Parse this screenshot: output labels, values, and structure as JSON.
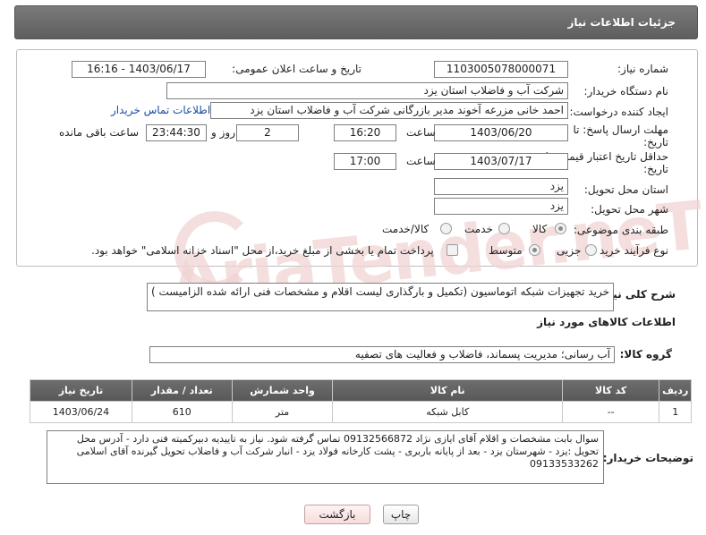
{
  "header": {
    "title": "جزئیات اطلاعات نیاز"
  },
  "form": {
    "need_number_label": "شماره نیاز:",
    "need_number": "1103005078000071",
    "announce_label": "تاریخ و ساعت اعلان عمومی:",
    "announce_value": "1403/06/17 - 16:16",
    "buyer_org_label": "نام دستگاه خریدار:",
    "buyer_org": "شرکت آب و فاضلاب استان یزد",
    "requester_label": "ایجاد کننده درخواست:",
    "requester": "احمد خانی مزرعه آخوند مدیر بازرگانی شرکت آب و فاضلاب استان یزد",
    "contact_link": "اطلاعات تماس خریدار",
    "deadline_label_1": "مهلت ارسال پاسخ: تا",
    "deadline_label_2": "تاریخ:",
    "deadline_date": "1403/06/20",
    "time_label": "ساعت",
    "deadline_time": "16:20",
    "days_value": "2",
    "days_label": "روز و",
    "remaining_time": "23:44:30",
    "remaining_label": "ساعت باقی مانده",
    "validity_label_1": "حداقل تاریخ اعتبار قیمت: تا",
    "validity_label_2": "تاریخ:",
    "validity_date": "1403/07/17",
    "validity_time": "17:00",
    "province_label": "استان محل تحویل:",
    "province": "یزد",
    "city_label": "شهر محل تحویل:",
    "city": "یزد",
    "category_label": "طبقه بندی موضوعی:",
    "category_options": [
      "کالا",
      "خدمت",
      "کالا/خدمت"
    ],
    "purchase_type_label": "نوع فرآیند خرید :",
    "purchase_options": [
      "جزیی",
      "متوسط"
    ],
    "payment_note": "پرداخت تمام یا بخشی از مبلغ خرید،از محل \"اسناد خزانه اسلامی\" خواهد بود."
  },
  "description": {
    "label": "شرح کلی نیاز:",
    "text": "خرید تجهیزات شبکه اتوماسیون  (تکمیل و بارگذاری لیست اقلام و مشخصات فنی ارائه شده الزامیست )"
  },
  "goods_section": {
    "title": "اطلاعات کالاهای مورد نیاز",
    "group_label": "گروه کالا:",
    "group_value": "آب رسانی؛ مدیریت پسماند، فاضلاب و فعالیت های تصفیه"
  },
  "table": {
    "headers": [
      "ردیف",
      "کد کالا",
      "نام کالا",
      "واحد شمارش",
      "تعداد / مقدار",
      "تاریخ نیاز"
    ],
    "rows": [
      [
        "1",
        "--",
        "کابل شبکه",
        "متر",
        "610",
        "1403/06/24"
      ]
    ]
  },
  "buyer_notes": {
    "label": "توضیحات خریدار:",
    "text": "سوال بابت مشخصات و اقلام آقای ایازی نژاد 09132566872 تماس گرفته شود. نیاز به تاییدیه دبیرکمیته فنی دارد - آدرس محل تحویل :یزد - شهرستان یزد - بعد از پایانه باربری - پشت کارخانه فولاد یزد - انبار شرکت آب و فاضلاب تحویل گیرنده آقای اسلامی  09133533262"
  },
  "buttons": {
    "print": "چاپ",
    "back": "بازگشت"
  },
  "colors": {
    "header_bg": "#666666",
    "link": "#1a4ea8",
    "watermark": "#f1d4d4"
  }
}
